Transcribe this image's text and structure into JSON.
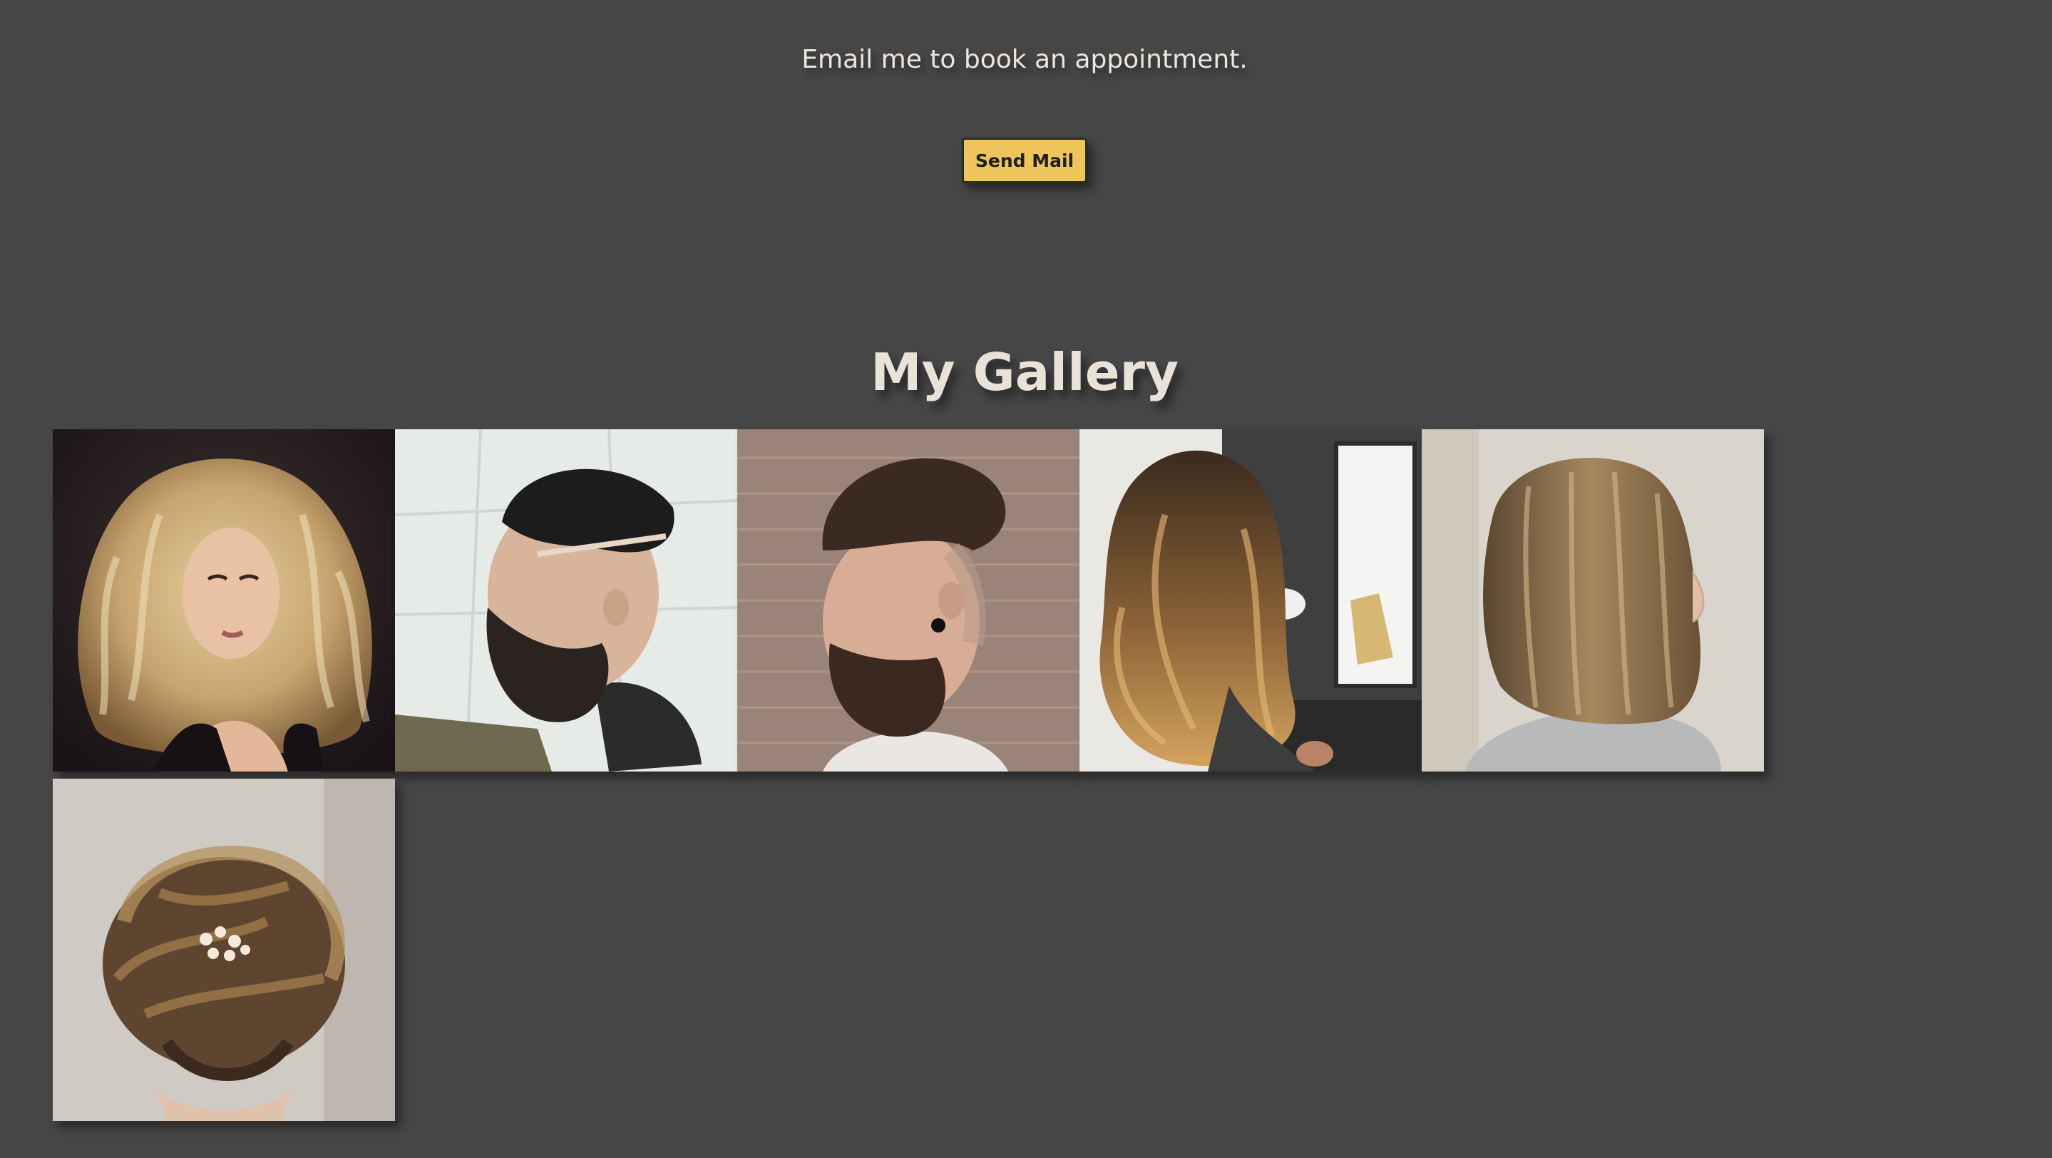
{
  "contact": {
    "message": "Email me to book an appointment.",
    "button_label": "Send Mail"
  },
  "gallery": {
    "title": "My Gallery",
    "images": [
      {
        "name": "gallery-image-voluminous-blonde-waves"
      },
      {
        "name": "gallery-image-pompadour-fade-beard"
      },
      {
        "name": "gallery-image-textured-undercut-beard"
      },
      {
        "name": "gallery-image-layered-balayage"
      },
      {
        "name": "gallery-image-highlighted-bob"
      },
      {
        "name": "gallery-image-updo-bun"
      }
    ]
  },
  "colors": {
    "background": "#464646",
    "accent": "#eec55a",
    "text": "#ece6dc"
  }
}
